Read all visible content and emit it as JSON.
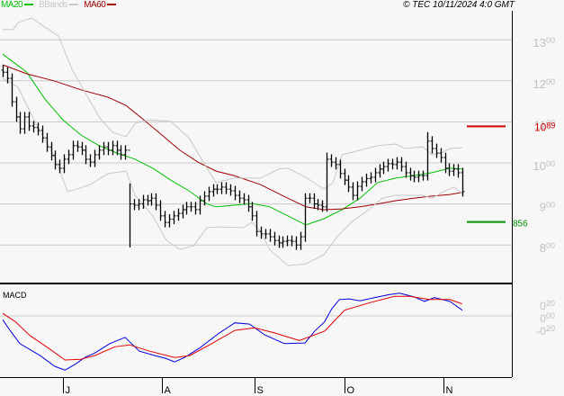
{
  "legend": {
    "ma20": {
      "label": "MA20",
      "color": "#00c000"
    },
    "bbands": {
      "label": "BBands",
      "color": "#c8c8c8"
    },
    "ma60": {
      "label": "MA60",
      "color": "#a00000"
    }
  },
  "copyright": "© TEC 10/11/2024 4:0 GMT",
  "chart_data": [
    {
      "type": "line",
      "title": "Price (bar chart with MA20, MA60, Bollinger Bands)",
      "ylim": [
        7.3,
        13.9
      ],
      "x_range": [
        0,
        106.9
      ],
      "grid": true,
      "y_ticks": [
        {
          "value": 13,
          "int": "13",
          "dec": "00"
        },
        {
          "value": 12,
          "int": "12",
          "dec": "00"
        },
        {
          "value": 11,
          "int": "11",
          "dec": "00"
        },
        {
          "value": 10,
          "int": "10",
          "dec": "00"
        },
        {
          "value": 9,
          "int": "9",
          "dec": "00"
        },
        {
          "value": 8,
          "int": "8",
          "dec": "00"
        }
      ],
      "x_ticks": [
        {
          "t": 14.0,
          "label": "J"
        },
        {
          "t": 37.0,
          "label": "A"
        },
        {
          "t": 58.6,
          "label": "S"
        },
        {
          "t": 79.5,
          "label": "O"
        },
        {
          "t": 102.5,
          "label": "N"
        }
      ],
      "closes": [
        12.21,
        12.06,
        11.49,
        11.12,
        10.83,
        11.12,
        10.9,
        10.86,
        10.79,
        10.61,
        10.39,
        10.18,
        9.96,
        9.87,
        10.09,
        10.2,
        10.42,
        10.39,
        10.31,
        10.09,
        10.02,
        10.2,
        10.31,
        10.39,
        10.31,
        10.42,
        10.31,
        10.2,
        10.31,
        9.0,
        8.97,
        9.0,
        9.1,
        9.08,
        9.14,
        8.97,
        8.71,
        8.55,
        8.63,
        8.71,
        8.77,
        8.86,
        8.93,
        8.93,
        8.86,
        9.08,
        9.19,
        9.3,
        9.36,
        9.36,
        9.41,
        9.36,
        9.32,
        9.21,
        9.14,
        9.1,
        8.93,
        8.71,
        8.33,
        8.27,
        8.27,
        8.2,
        8.11,
        8.05,
        8.09,
        8.11,
        8.09,
        8.0,
        8.2,
        9.14,
        9.14,
        9.0,
        8.97,
        8.93,
        10.09,
        10.02,
        9.96,
        9.74,
        9.58,
        9.41,
        9.21,
        9.43,
        9.54,
        9.62,
        9.65,
        9.76,
        9.85,
        9.91,
        9.98,
        9.96,
        10.02,
        9.91,
        9.76,
        9.69,
        9.65,
        9.69,
        9.69,
        10.53,
        10.35,
        10.24,
        10.13,
        9.87,
        9.8,
        9.85,
        9.76,
        9.3
      ],
      "bar_overrides": {
        "29": {
          "low": 7.94,
          "high": 9.5
        },
        "74": {
          "high": 10.25
        },
        "97": {
          "high": 10.75
        }
      },
      "series": [
        {
          "name": "MA20",
          "color": "#00c000",
          "points": [
            [
              0,
              12.65
            ],
            [
              5.6,
              12.21
            ],
            [
              9.8,
              11.56
            ],
            [
              14,
              11.05
            ],
            [
              18.2,
              10.68
            ],
            [
              22.4,
              10.42
            ],
            [
              26.6,
              10.24
            ],
            [
              30.8,
              10.09
            ],
            [
              34.9,
              9.87
            ],
            [
              39.1,
              9.58
            ],
            [
              43.3,
              9.32
            ],
            [
              47.5,
              9.0
            ],
            [
              49.6,
              8.93
            ],
            [
              53.8,
              8.97
            ],
            [
              58,
              9.01
            ],
            [
              62.1,
              8.93
            ],
            [
              66.3,
              8.71
            ],
            [
              70.5,
              8.49
            ],
            [
              74.7,
              8.64
            ],
            [
              78.9,
              8.86
            ],
            [
              83.1,
              9.14
            ],
            [
              87.2,
              9.52
            ],
            [
              91.4,
              9.63
            ],
            [
              95.6,
              9.69
            ],
            [
              99.8,
              9.76
            ],
            [
              104,
              9.87
            ],
            [
              106.9,
              9.85
            ]
          ]
        },
        {
          "name": "MA60",
          "color": "#a00000",
          "points": [
            [
              0,
              12.39
            ],
            [
              5.6,
              12.17
            ],
            [
              11.9,
              12.0
            ],
            [
              18.2,
              11.78
            ],
            [
              24.5,
              11.6
            ],
            [
              28.7,
              11.4
            ],
            [
              32.8,
              11.05
            ],
            [
              37,
              10.68
            ],
            [
              41.2,
              10.31
            ],
            [
              45.4,
              10.02
            ],
            [
              49.6,
              9.8
            ],
            [
              53.8,
              9.69
            ],
            [
              60,
              9.47
            ],
            [
              62.1,
              9.36
            ],
            [
              66.3,
              9.14
            ],
            [
              70.5,
              8.93
            ],
            [
              74.7,
              8.86
            ],
            [
              78.9,
              8.88
            ],
            [
              83.1,
              8.93
            ],
            [
              87.2,
              9.0
            ],
            [
              91.4,
              9.08
            ],
            [
              95.6,
              9.14
            ],
            [
              99.8,
              9.19
            ],
            [
              104,
              9.23
            ],
            [
              106.9,
              9.28
            ]
          ]
        },
        {
          "name": "BBands upper",
          "color": "#c8c8c8",
          "points": [
            [
              0,
              13.25
            ],
            [
              2.5,
              13.25
            ],
            [
              3.6,
              13.42
            ],
            [
              6.7,
              13.53
            ],
            [
              9.8,
              13.31
            ],
            [
              13,
              13.09
            ],
            [
              16.1,
              12.28
            ],
            [
              19.2,
              11.71
            ],
            [
              22.4,
              11.12
            ],
            [
              25.5,
              10.75
            ],
            [
              28.7,
              10.64
            ],
            [
              30.8,
              10.96
            ],
            [
              33.9,
              11.05
            ],
            [
              39.1,
              11.01
            ],
            [
              43.3,
              10.61
            ],
            [
              47.5,
              9.87
            ],
            [
              49.6,
              9.52
            ],
            [
              53.8,
              9.63
            ],
            [
              58,
              9.63
            ],
            [
              60,
              9.63
            ],
            [
              64.2,
              9.85
            ],
            [
              66.3,
              9.87
            ],
            [
              70.5,
              9.65
            ],
            [
              74.7,
              9.36
            ],
            [
              76.8,
              9.52
            ],
            [
              78.9,
              10.2
            ],
            [
              83.1,
              10.31
            ],
            [
              87.2,
              10.42
            ],
            [
              91.4,
              10.46
            ],
            [
              93.5,
              10.35
            ],
            [
              97.7,
              10.39
            ],
            [
              99.8,
              10.2
            ],
            [
              101.9,
              10.24
            ],
            [
              104,
              10.35
            ],
            [
              106.9,
              10.37
            ]
          ]
        },
        {
          "name": "BBands lower",
          "color": "#c8c8c8",
          "points": [
            [
              0,
              12.06
            ],
            [
              3.6,
              11.84
            ],
            [
              7.7,
              10.96
            ],
            [
              11.9,
              10.18
            ],
            [
              15.1,
              9.3
            ],
            [
              17.2,
              9.36
            ],
            [
              20.3,
              9.47
            ],
            [
              24.5,
              9.74
            ],
            [
              28.7,
              9.8
            ],
            [
              30.8,
              9.21
            ],
            [
              34.9,
              8.71
            ],
            [
              38.1,
              8.11
            ],
            [
              41.2,
              7.89
            ],
            [
              44.4,
              7.98
            ],
            [
              47.5,
              8.42
            ],
            [
              50.6,
              8.44
            ],
            [
              55.9,
              8.42
            ],
            [
              58,
              8.55
            ],
            [
              60,
              8.33
            ],
            [
              62.1,
              7.89
            ],
            [
              66.3,
              7.5
            ],
            [
              70.5,
              7.54
            ],
            [
              74.7,
              7.76
            ],
            [
              77.8,
              8.2
            ],
            [
              81,
              8.55
            ],
            [
              85.1,
              8.86
            ],
            [
              88.3,
              9.14
            ],
            [
              91.4,
              9.21
            ],
            [
              97.7,
              9.21
            ],
            [
              99.8,
              9.14
            ],
            [
              102.9,
              9.32
            ],
            [
              105,
              9.41
            ],
            [
              106.9,
              9.25
            ]
          ]
        }
      ],
      "levels": [
        {
          "name": "resistance",
          "value": 10.89,
          "int": "10",
          "dec": "89",
          "color": "#d00000"
        },
        {
          "name": "support",
          "value": 8.56,
          "int": "",
          "dec": "856",
          "color": "#009000"
        }
      ]
    },
    {
      "type": "line",
      "title": "MACD",
      "ylim": [
        -1.0,
        0.52
      ],
      "x_range": [
        0,
        106.9
      ],
      "y_ticks": [
        {
          "value": 0.2,
          "int": "0",
          "dec": "20"
        },
        {
          "value": 0.0,
          "int": "0",
          "dec": "00"
        },
        {
          "value": -0.2,
          "int": "-0",
          "dec": "20"
        }
      ],
      "series": [
        {
          "name": "MACD",
          "color": "#0000e0",
          "points": [
            [
              0,
              -0.06
            ],
            [
              1.7,
              -0.23
            ],
            [
              4,
              -0.44
            ],
            [
              8.7,
              -0.63
            ],
            [
              12.1,
              -0.8
            ],
            [
              14.5,
              -0.86
            ],
            [
              16.8,
              -0.77
            ],
            [
              19.1,
              -0.66
            ],
            [
              21.4,
              -0.59
            ],
            [
              24.9,
              -0.44
            ],
            [
              28.5,
              -0.34
            ],
            [
              29.5,
              -0.41
            ],
            [
              31.8,
              -0.56
            ],
            [
              35.4,
              -0.63
            ],
            [
              37.7,
              -0.67
            ],
            [
              40,
              -0.73
            ],
            [
              42.3,
              -0.66
            ],
            [
              45.8,
              -0.51
            ],
            [
              50.4,
              -0.27
            ],
            [
              54,
              -0.11
            ],
            [
              57.4,
              -0.13
            ],
            [
              60.9,
              -0.3
            ],
            [
              65.5,
              -0.44
            ],
            [
              70.3,
              -0.43
            ],
            [
              72.6,
              -0.24
            ],
            [
              74.9,
              -0.09
            ],
            [
              76.5,
              0.11
            ],
            [
              78.3,
              0.26
            ],
            [
              80.6,
              0.27
            ],
            [
              83.1,
              0.24
            ],
            [
              86.4,
              0.29
            ],
            [
              90,
              0.34
            ],
            [
              92.3,
              0.36
            ],
            [
              95.8,
              0.3
            ],
            [
              98.1,
              0.23
            ],
            [
              100.4,
              0.29
            ],
            [
              104,
              0.23
            ],
            [
              106.9,
              0.09
            ]
          ]
        },
        {
          "name": "Signal",
          "color": "#e00000",
          "points": [
            [
              0,
              0.04
            ],
            [
              2.9,
              -0.09
            ],
            [
              6.3,
              -0.31
            ],
            [
              11,
              -0.53
            ],
            [
              14.5,
              -0.7
            ],
            [
              18,
              -0.69
            ],
            [
              21.4,
              -0.63
            ],
            [
              26.1,
              -0.49
            ],
            [
              29.5,
              -0.46
            ],
            [
              34.2,
              -0.56
            ],
            [
              40,
              -0.66
            ],
            [
              43.5,
              -0.63
            ],
            [
              48.1,
              -0.46
            ],
            [
              54,
              -0.23
            ],
            [
              58.6,
              -0.19
            ],
            [
              63.2,
              -0.27
            ],
            [
              69,
              -0.39
            ],
            [
              74.9,
              -0.24
            ],
            [
              79.5,
              0.09
            ],
            [
              85.4,
              0.21
            ],
            [
              91.1,
              0.31
            ],
            [
              94.6,
              0.31
            ],
            [
              99.2,
              0.26
            ],
            [
              104,
              0.26
            ],
            [
              106.9,
              0.19
            ]
          ]
        }
      ],
      "label": "MACD"
    }
  ]
}
